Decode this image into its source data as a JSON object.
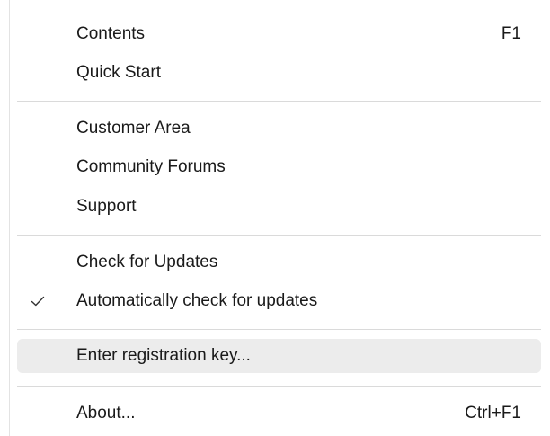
{
  "menu": {
    "items": [
      {
        "label": "Contents",
        "shortcut": "F1"
      },
      {
        "label": "Quick Start",
        "shortcut": ""
      },
      {
        "label": "Customer Area",
        "shortcut": ""
      },
      {
        "label": "Community Forums",
        "shortcut": ""
      },
      {
        "label": "Support",
        "shortcut": ""
      },
      {
        "label": "Check for Updates",
        "shortcut": ""
      },
      {
        "label": "Automatically check for updates",
        "shortcut": "",
        "checked": true
      },
      {
        "label": "Enter registration key...",
        "shortcut": "",
        "highlighted": true
      },
      {
        "label": "About...",
        "shortcut": "Ctrl+F1"
      }
    ]
  },
  "colors": {
    "hover_background": "#ececec",
    "separator": "#dadada",
    "text": "#1a1a1a"
  }
}
